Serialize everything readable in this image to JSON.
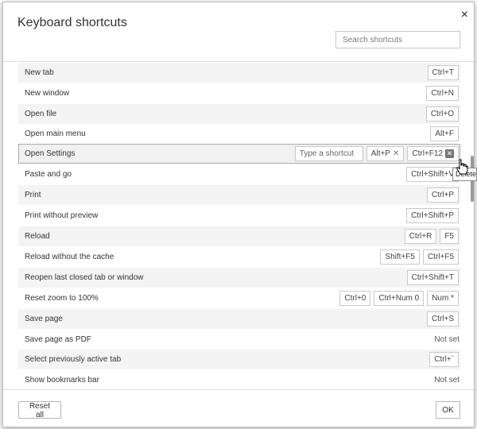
{
  "background_text": "... ",
  "dialog": {
    "title": "Keyboard shortcuts",
    "close_glyph": "×",
    "search_placeholder": "Search shortcuts"
  },
  "shortcuts": [
    {
      "label": "New tab",
      "keys": [
        "Ctrl+T"
      ]
    },
    {
      "label": "New window",
      "keys": [
        "Ctrl+N"
      ]
    },
    {
      "label": "Open file",
      "keys": [
        "Ctrl+O"
      ]
    },
    {
      "label": "Open main menu",
      "keys": [
        "Alt+F"
      ]
    },
    {
      "label": "Open Settings",
      "type_placeholder": "Type a shortcut",
      "keys": [
        "Alt+P",
        "Ctrl+F12"
      ]
    },
    {
      "label": "Paste and go",
      "keys": [
        "Ctrl+Shift+V"
      ]
    },
    {
      "label": "Print",
      "keys": [
        "Ctrl+P"
      ]
    },
    {
      "label": "Print without preview",
      "keys": [
        "Ctrl+Shift+P"
      ]
    },
    {
      "label": "Reload",
      "keys": [
        "Ctrl+R",
        "F5"
      ]
    },
    {
      "label": "Reload without the cache",
      "keys": [
        "Shift+F5",
        "Ctrl+F5"
      ]
    },
    {
      "label": "Reopen last closed tab or window",
      "keys": [
        "Ctrl+Shift+T"
      ]
    },
    {
      "label": "Reset zoom to 100%",
      "keys": [
        "Ctrl+0",
        "Ctrl+Num 0",
        "Num *"
      ]
    },
    {
      "label": "Save page",
      "keys": [
        "Ctrl+S"
      ]
    },
    {
      "label": "Save page as PDF",
      "not_set": "Not set"
    },
    {
      "label": "Select previously active tab",
      "keys": [
        "Ctrl+`"
      ]
    },
    {
      "label": "Show bookmarks bar",
      "not_set": "Not set"
    }
  ],
  "tooltip": "Delete",
  "footer": {
    "reset_label": "Reset all",
    "ok_label": "OK"
  }
}
